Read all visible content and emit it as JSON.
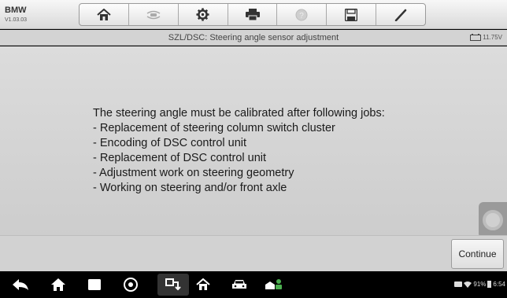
{
  "app": {
    "name": "BMW",
    "version": "V1.03.03"
  },
  "toolbar": {
    "buttons": [
      {
        "icon": "home-icon"
      },
      {
        "icon": "vehicle-swap-icon",
        "disabled": true
      },
      {
        "icon": "gear-icon"
      },
      {
        "icon": "print-icon"
      },
      {
        "icon": "help-icon",
        "disabled": true
      },
      {
        "icon": "save-icon"
      },
      {
        "icon": "pen-icon"
      }
    ]
  },
  "title": "SZL/DSC: Steering angle sensor adjustment",
  "battery_voltage": "11.75V",
  "message": {
    "lines": [
      "The steering angle must be calibrated after following jobs:",
      "- Replacement of steering column switch cluster",
      "- Encoding of DSC control unit",
      "- Replacement of DSC control unit",
      "- Adjustment work on steering geometry",
      "- Working on steering and/or front axle"
    ]
  },
  "actions": {
    "continue_label": "Continue"
  },
  "status_bar": {
    "battery_percent": "91%",
    "time": "6:54"
  },
  "colors": {
    "content_bg": "#d5d5d5",
    "navbar_bg": "#000000"
  }
}
